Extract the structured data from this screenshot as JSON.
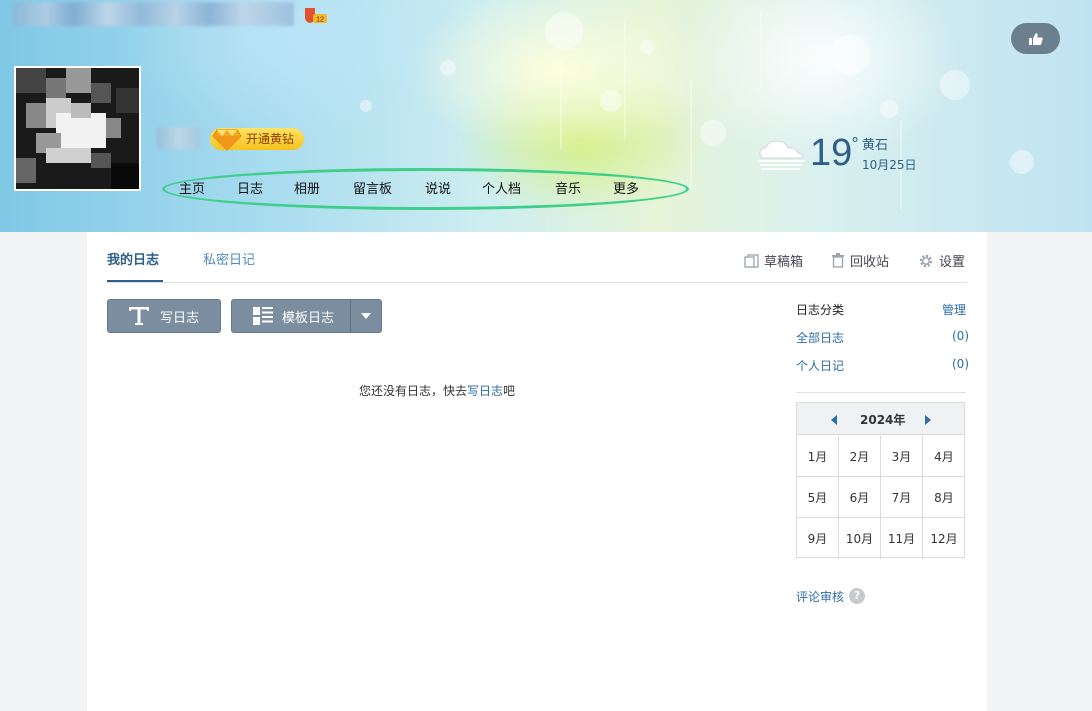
{
  "header": {
    "vip_label": "开通黄钻",
    "nav": [
      "主页",
      "日志",
      "相册",
      "留言板",
      "说说",
      "个人档",
      "音乐",
      "更多"
    ],
    "weather": {
      "temp": "19",
      "degree": "°",
      "city": "黄石",
      "date": "10月25日",
      "icon": "cloud-icon"
    },
    "like_icon": "thumbs-up-icon"
  },
  "tabs": {
    "active": "我的日志",
    "other": "私密日记"
  },
  "toolbar": {
    "drafts": "草稿箱",
    "trash": "回收站",
    "settings": "设置"
  },
  "actions": {
    "write": "写日志",
    "template": "模板日志"
  },
  "empty": {
    "prefix": "您还没有日志，快去",
    "link": "写日志",
    "suffix": "吧"
  },
  "sidebar": {
    "title": "日志分类",
    "manage": "管理",
    "categories": [
      {
        "label": "全部日志",
        "count": "(0)"
      },
      {
        "label": "个人日记",
        "count": "(0)"
      }
    ],
    "calendar": {
      "year": "2024年",
      "months": [
        "1月",
        "2月",
        "3月",
        "4月",
        "5月",
        "6月",
        "7月",
        "8月",
        "9月",
        "10月",
        "11月",
        "12月"
      ]
    },
    "review": "评论审核",
    "help": "?"
  },
  "colors": {
    "accent": "#2c5f8a",
    "link": "#2c6ea8",
    "nav_highlight": "#3fcf8a",
    "button": "#7b8ea0"
  }
}
